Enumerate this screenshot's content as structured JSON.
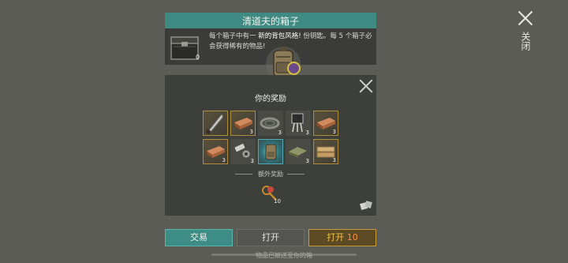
{
  "close": {
    "label": "关闭"
  },
  "header": {
    "title": "清道夫的箱子"
  },
  "crate": {
    "count": "0"
  },
  "description": {
    "part1": "每个箱子中有一",
    "highlight": "新的背包风格!",
    "part2": "份钥匙。每 5 个箱子必会获得稀有的物品!"
  },
  "reward_panel": {
    "title": "你的奖励",
    "items": [
      {
        "icon": "machete-icon",
        "qty": ""
      },
      {
        "icon": "copper-bar-icon",
        "qty": "3"
      },
      {
        "icon": "rope-coil-icon",
        "qty": "3"
      },
      {
        "icon": "transistor-icon",
        "qty": "3"
      },
      {
        "icon": "copper-bar-icon",
        "qty": "3"
      },
      {
        "icon": "copper-bar-icon",
        "qty": "3"
      },
      {
        "icon": "bolts-icon",
        "qty": "3"
      },
      {
        "icon": "backpack-icon",
        "qty": ""
      },
      {
        "icon": "cloth-icon",
        "qty": "3"
      },
      {
        "icon": "wood-plank-icon",
        "qty": "3"
      }
    ],
    "extra_label": "额外奖励",
    "extra_item": {
      "icon": "keys-icon",
      "qty": "10"
    }
  },
  "buttons": {
    "trade": "交易",
    "open": "打开",
    "open10_label": "打开",
    "open10_count": "10"
  },
  "footer": "物品已被送至你的箱"
}
